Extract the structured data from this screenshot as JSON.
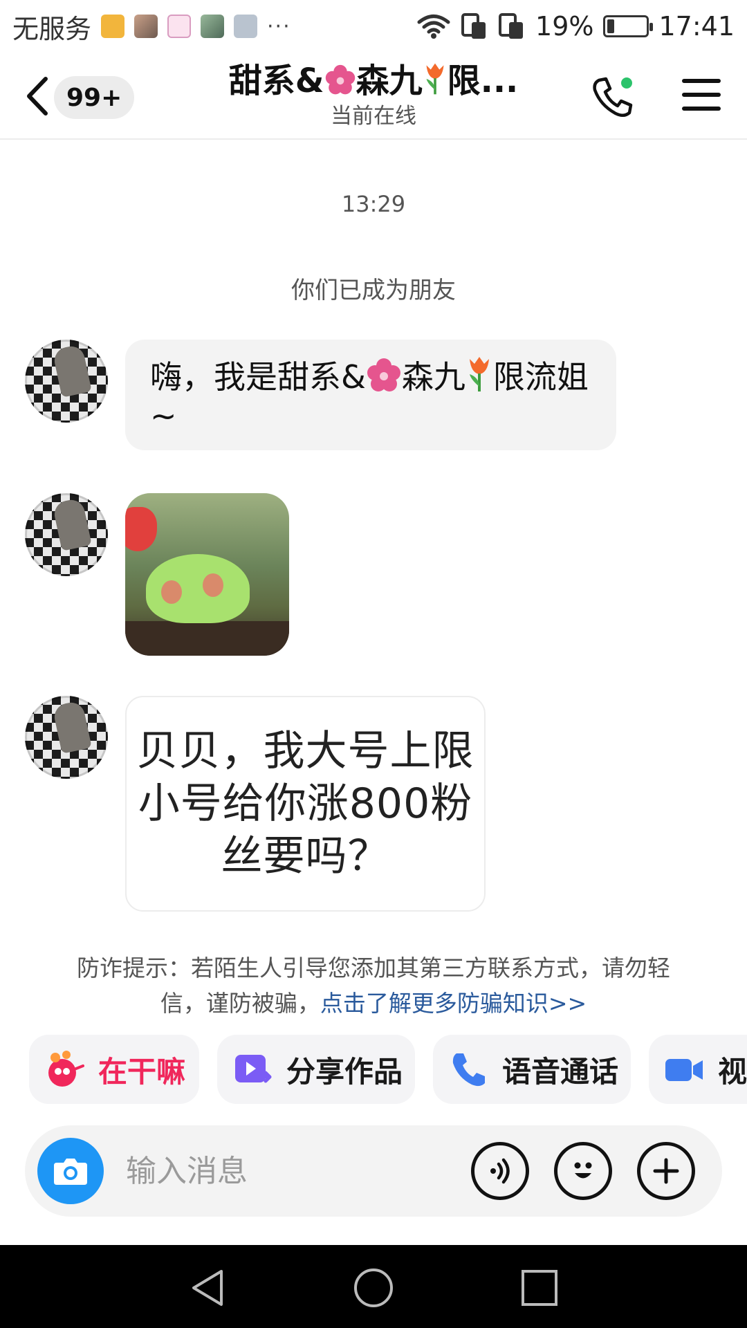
{
  "status_bar": {
    "carrier": "无服务",
    "more": "···",
    "battery_text": "19%",
    "battery_level": 0.19,
    "time": "17:41",
    "icons": [
      "wifi-icon",
      "sim-icon",
      "sim-icon",
      "battery-icon"
    ]
  },
  "header": {
    "badge": "99+",
    "title_part1": "甜系&",
    "title_part2": "森九",
    "title_part3": "限...",
    "subtitle": "当前在线",
    "online_color": "#2cc36b"
  },
  "chat": {
    "time": "13:29",
    "system_note": "你们已成为朋友",
    "messages": [
      {
        "type": "text",
        "part1": "嗨，我是甜系&",
        "part2": "森九",
        "part3": "限流姐~"
      },
      {
        "type": "sticker",
        "icon": "frog-sticker"
      },
      {
        "type": "card",
        "text": "贝贝，我大号上限小号给你涨800粉丝要吗？"
      }
    ]
  },
  "fraud_tip": {
    "text": "防诈提示：若陌生人引导您添加其第三方联系方式，请勿轻信，谨防被骗，",
    "link": "点击了解更多防骗知识>>",
    "link_color": "#2a5a9c"
  },
  "quick_actions": [
    {
      "label": "在干嘛",
      "icon": "wave-icon",
      "color": "#f0275b"
    },
    {
      "label": "分享作品",
      "icon": "share-video-icon",
      "color": "#7b5cf5"
    },
    {
      "label": "语音通话",
      "icon": "phone-icon",
      "color": "#3f7df0"
    },
    {
      "label": "视频",
      "icon": "video-icon",
      "color": "#3f7df0"
    }
  ],
  "input_bar": {
    "placeholder": "输入消息",
    "camera_color": "#1e96f5"
  }
}
